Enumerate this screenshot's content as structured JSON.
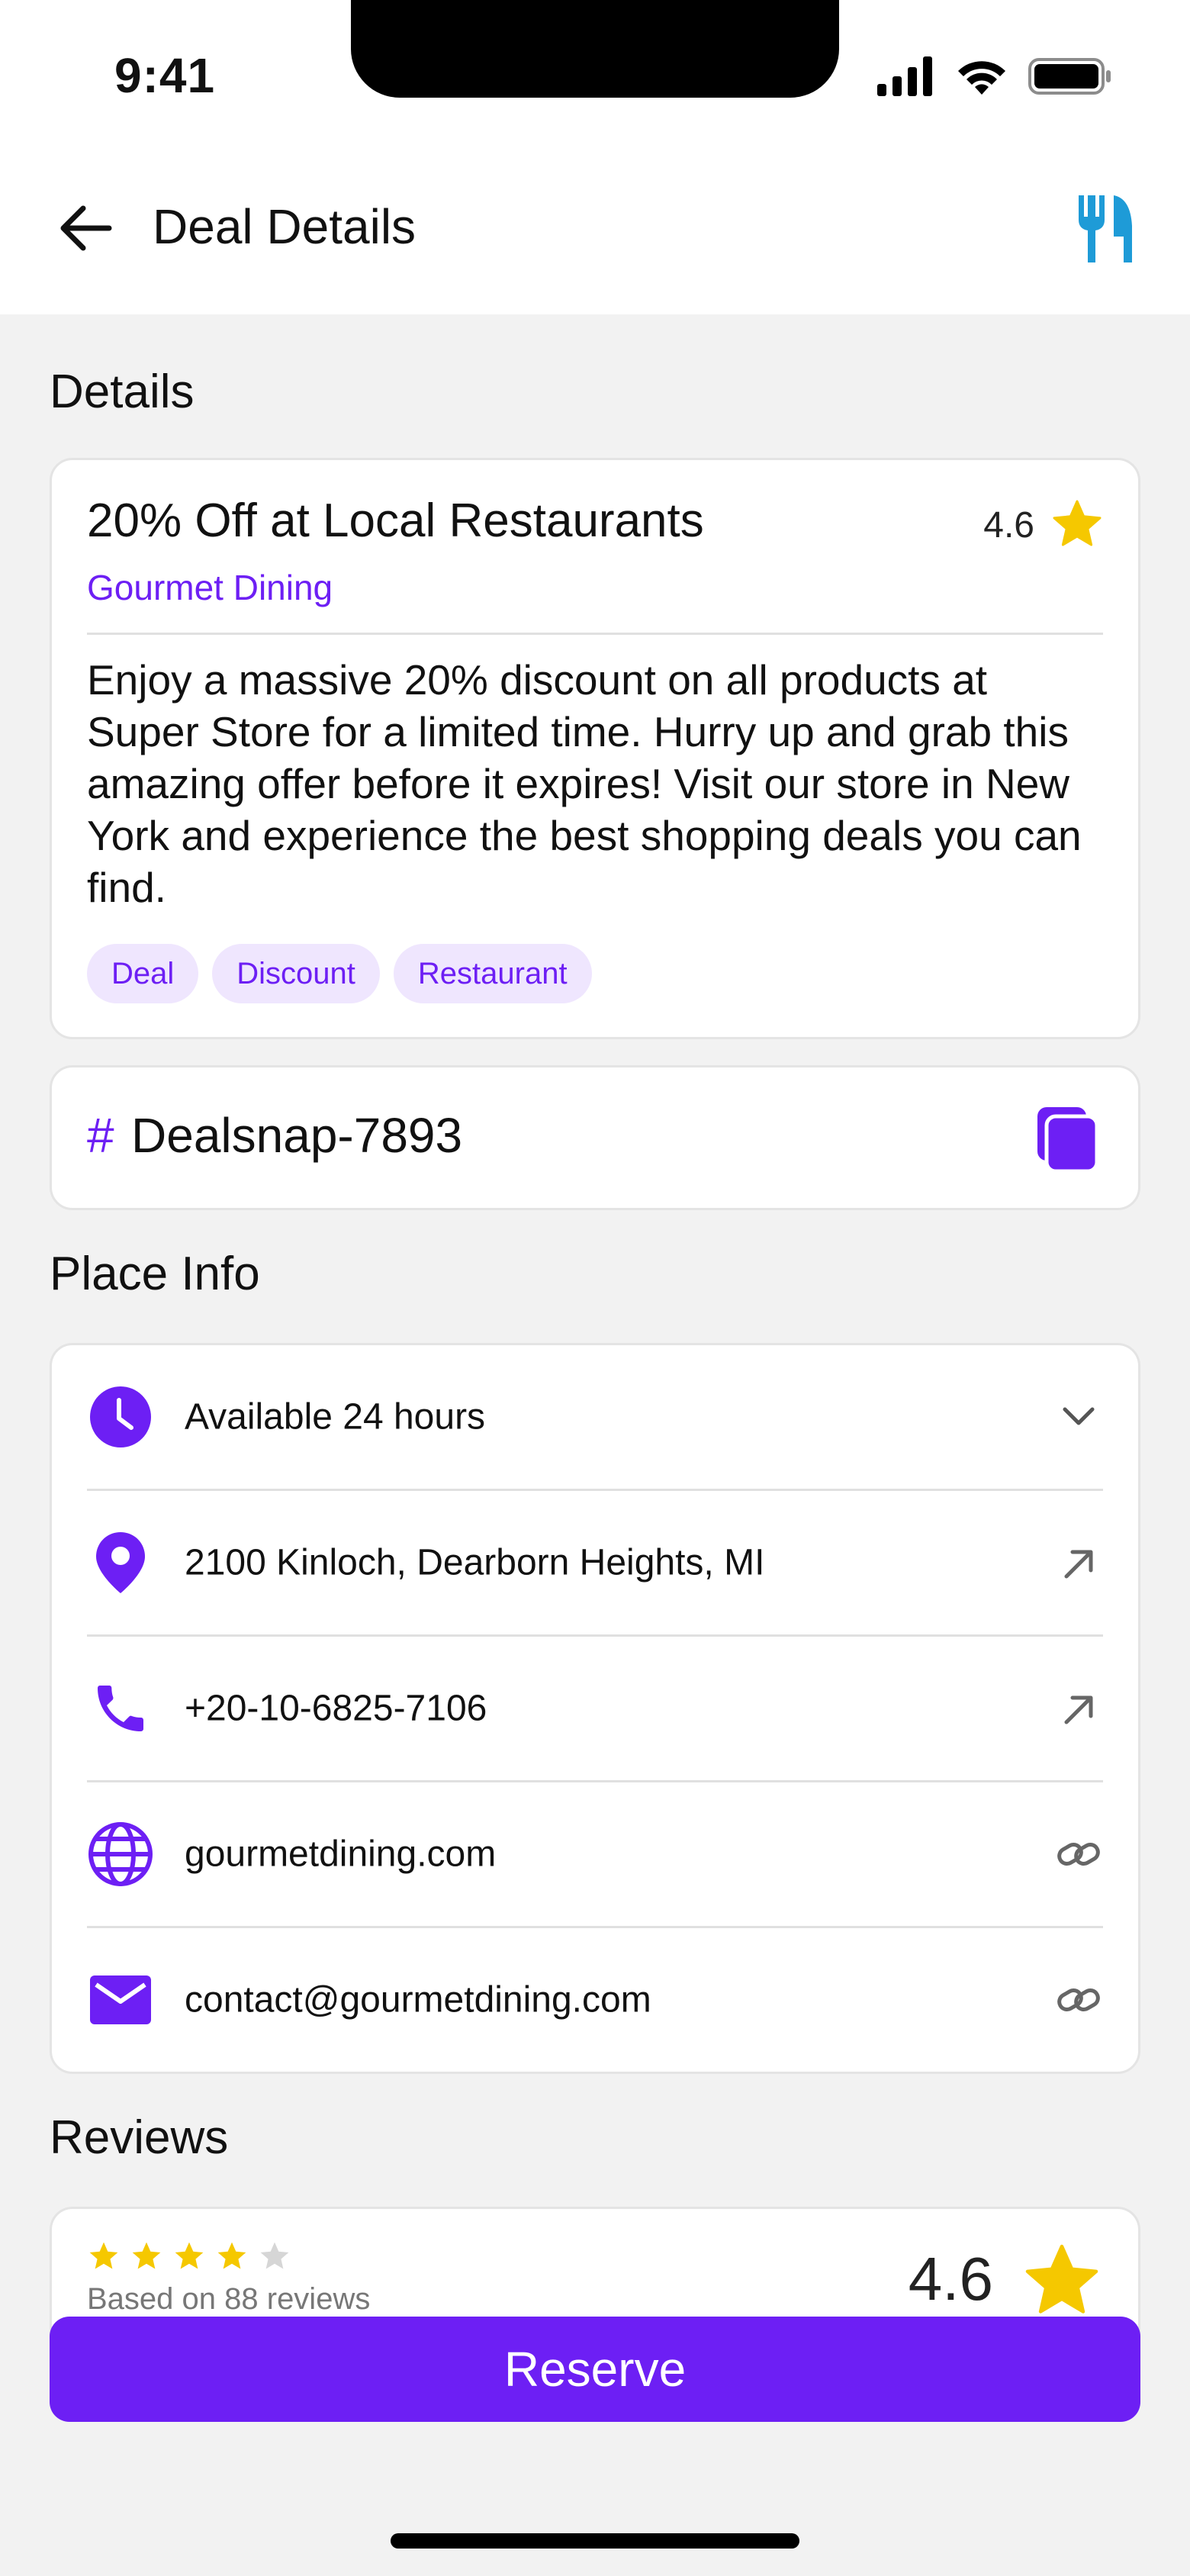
{
  "status_bar": {
    "time": "9:41"
  },
  "header": {
    "title": "Deal Details",
    "back_icon": "arrow-left-icon",
    "brand_icon": "utensils-icon"
  },
  "details": {
    "section_title": "Details",
    "deal": {
      "title": "20% Off at Local Restaurants",
      "category": "Gourmet Dining",
      "rating": "4.6",
      "description": "Enjoy a massive 20% discount on all products at Super Store for a limited time. Hurry up and grab this amazing offer before it expires! Visit our store in New York and experience the best shopping deals you can find.",
      "tags": [
        "Deal",
        "Discount",
        "Restaurant"
      ]
    },
    "code": {
      "hash": "#",
      "value": "Dealsnap-7893",
      "copy_icon": "copy-icon"
    }
  },
  "place_info": {
    "section_title": "Place Info",
    "rows": [
      {
        "icon": "clock-icon",
        "text": "Available 24 hours",
        "action_icon": "chevron-down-icon"
      },
      {
        "icon": "location-pin-icon",
        "text": "2100 Kinloch, Dearborn Heights, MI",
        "action_icon": "arrow-up-right-icon"
      },
      {
        "icon": "phone-icon",
        "text": "+20-10-6825-7106",
        "action_icon": "arrow-up-right-icon"
      },
      {
        "icon": "globe-icon",
        "text": "gourmetdining.com",
        "action_icon": "link-icon"
      },
      {
        "icon": "mail-icon",
        "text": "contact@gourmetdining.com",
        "action_icon": "link-icon"
      }
    ]
  },
  "reviews": {
    "section_title": "Reviews",
    "stars_filled": 4,
    "stars_total": 5,
    "count_text": "Based on 88 reviews",
    "average": "4.6"
  },
  "cta": {
    "reserve_label": "Reserve"
  },
  "colors": {
    "accent": "#6d1ff4",
    "star": "#f5c800",
    "brand_icon": "#1e9bd7",
    "background": "#f2f2f2"
  }
}
